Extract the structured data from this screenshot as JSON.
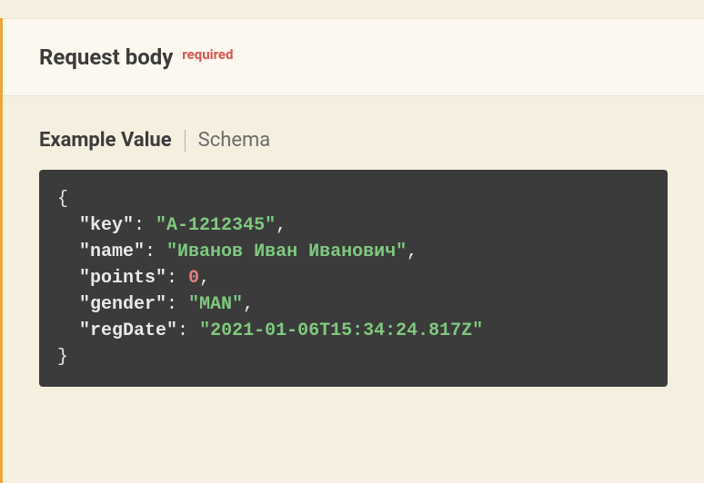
{
  "header": {
    "title": "Request body",
    "required_label": "required"
  },
  "tabs": {
    "example_value": "Example Value",
    "schema": "Schema"
  },
  "example": {
    "key_label": "\"key\"",
    "key_value": "\"A-1212345\"",
    "name_label": "\"name\"",
    "name_value": "\"Иванов Иван Иванович\"",
    "points_label": "\"points\"",
    "points_value": "0",
    "gender_label": "\"gender\"",
    "gender_value": "\"MAN\"",
    "regdate_label": "\"regDate\"",
    "regdate_value": "\"2021-01-06T15:34:24.817Z\""
  }
}
